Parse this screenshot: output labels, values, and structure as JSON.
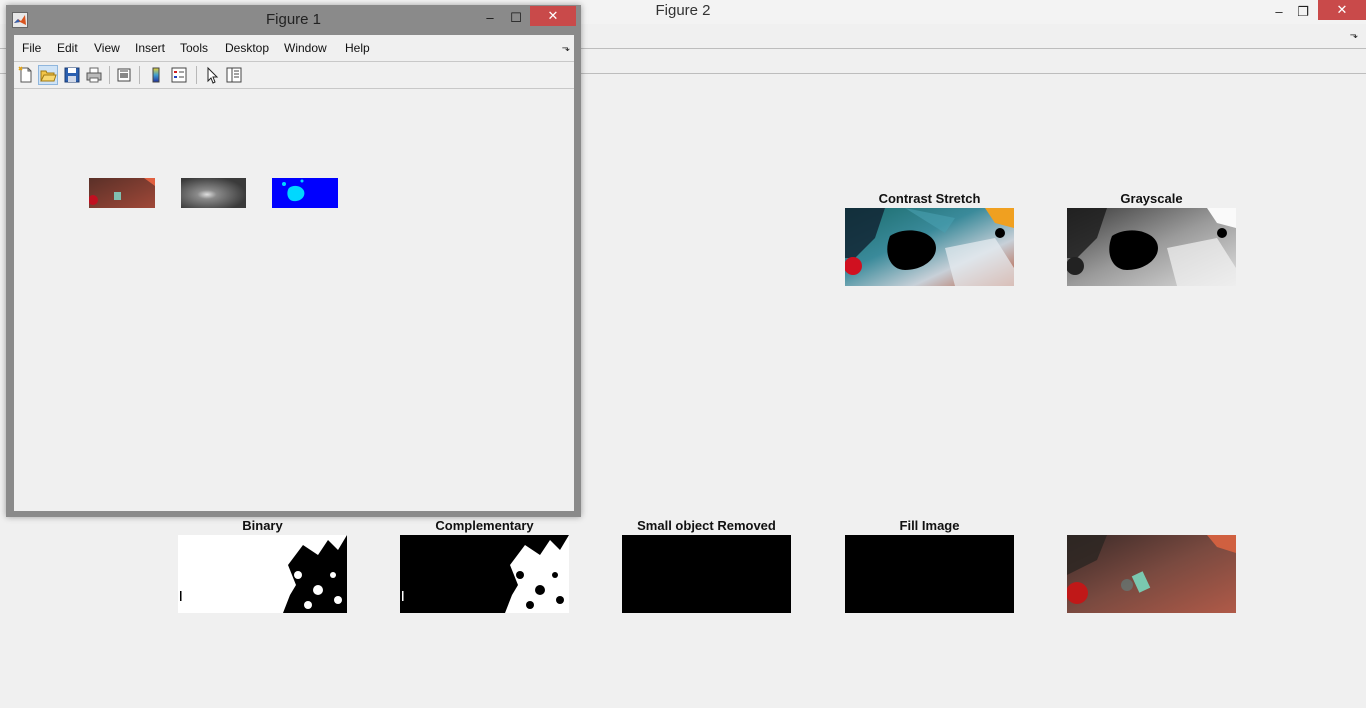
{
  "figure2": {
    "title": "Figure 2",
    "controls": {
      "minimize": "–",
      "restore": "❐",
      "close": "✕"
    },
    "expand": "⬎",
    "axes": [
      {
        "id": "contrast",
        "title": "Contrast Stretch"
      },
      {
        "id": "grayscale",
        "title": "Grayscale"
      },
      {
        "id": "binary",
        "title": "Binary"
      },
      {
        "id": "complementary",
        "title": "Complementary"
      },
      {
        "id": "small",
        "title": "Small object Removed"
      },
      {
        "id": "fill",
        "title": "Fill Image"
      },
      {
        "id": "result",
        "title": ""
      }
    ]
  },
  "figure1": {
    "title": "Figure 1",
    "controls": {
      "minimize": "–",
      "maximize": "☐",
      "close": "✕"
    },
    "menu": [
      "File",
      "Edit",
      "View",
      "Insert",
      "Tools",
      "Desktop",
      "Window",
      "Help"
    ],
    "expand": "⬎",
    "toolbar": [
      "new-figure-icon",
      "open-file-icon",
      "save-icon",
      "print-icon",
      "print-preview-icon",
      "colorbar-icon",
      "legend-icon",
      "pointer-icon",
      "property-inspector-icon"
    ]
  },
  "colors": {
    "close_red": "#c94a4a",
    "background": "#f0f0f0",
    "figure1_frame": "#8a8a8a",
    "segment_blue": "#0000ff",
    "segment_cyan": "#00d8ff"
  }
}
